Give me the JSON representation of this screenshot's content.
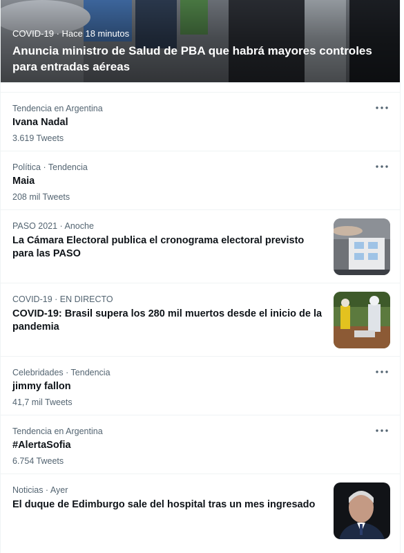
{
  "hero": {
    "meta": "COVID-19 · Hace 18 minutos",
    "headline": "Anuncia ministro de Salud de PBA que habrá mayores controles para entradas aéreas"
  },
  "trends": [
    {
      "meta": "Tendencia en Argentina",
      "title": "Ivana Nadal",
      "count": "3.619 Tweets"
    },
    {
      "meta": "Política · Tendencia",
      "title": "Maia",
      "count": "208 mil Tweets"
    },
    {
      "meta": "PASO 2021 · Anoche",
      "title": "La Cámara Electoral publica el cronograma electoral previsto para las PASO"
    },
    {
      "meta": "COVID-19 · EN DIRECTO",
      "title": "COVID-19: Brasil supera los 280 mil muertos desde el inicio de la pandemia"
    },
    {
      "meta": "Celebridades · Tendencia",
      "title": "jimmy fallon",
      "count": "41,7 mil Tweets"
    },
    {
      "meta": "Tendencia en Argentina",
      "title": "#AlertaSofia",
      "count": "6.754 Tweets"
    },
    {
      "meta": "Noticias · Ayer",
      "title": "El duque de Edimburgo sale del hospital tras un mes ingresado"
    }
  ],
  "icons": {
    "more": "more-horizontal-icon"
  },
  "colors": {
    "secondary_text": "#536471",
    "primary_text": "#0f1419",
    "divider": "#eff3f4"
  }
}
